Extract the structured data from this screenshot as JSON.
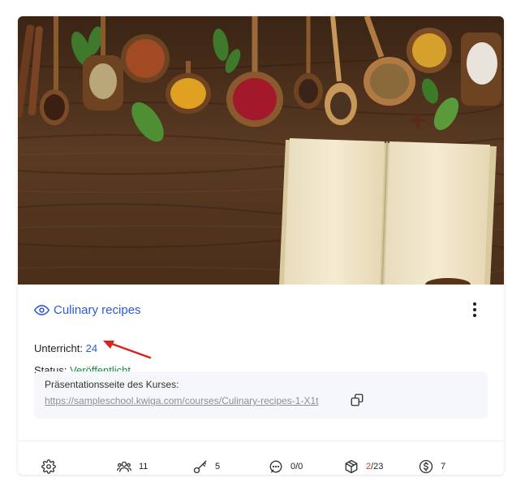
{
  "course": {
    "title": "Culinary recipes",
    "lessons_label": "Unterricht:",
    "lessons_count": "24",
    "status_label": "Status:",
    "status_value": "Veröffentlicht",
    "presentation_label": "Präsentationsseite des Kurses:",
    "presentation_url": "https://sampleschool.kwiga.com/courses/Culinary-recipes-1-X1t"
  },
  "stats": {
    "students": "11",
    "access_keys": "5",
    "comments": "0/0",
    "homework_done": "2",
    "homework_total": "/23",
    "price": "7"
  },
  "colors": {
    "accent": "#2d5bd6",
    "status_green": "#1f8a4a",
    "alert_red": "#d33a2c"
  },
  "icons": [
    "eye-icon",
    "more-vertical-icon",
    "copy-icon",
    "gear-icon",
    "users-icon",
    "key-icon",
    "chat-icon",
    "cube-icon",
    "dollar-icon"
  ]
}
